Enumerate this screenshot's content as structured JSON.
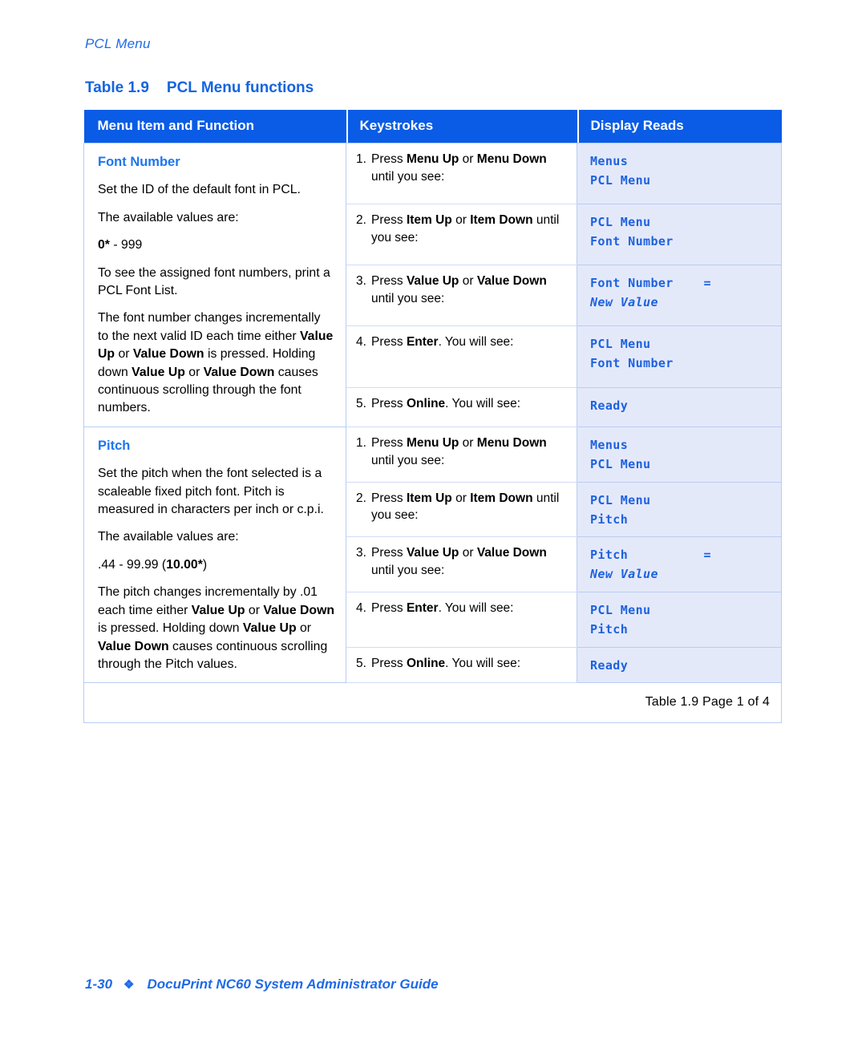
{
  "running_head": "PCL Menu",
  "table_caption": {
    "number": "Table 1.9",
    "title": "PCL Menu functions"
  },
  "colors": {
    "header_blue": "#0A5CE6",
    "accent_blue": "#1D75F0",
    "display_bg": "#E4E9FA",
    "display_text": "#1D62DE",
    "border_blue": "#B9CDF2"
  },
  "columns": [
    {
      "label": "Menu Item and Function"
    },
    {
      "label": "Keystrokes"
    },
    {
      "label": "Display Reads"
    }
  ],
  "sections": [
    {
      "function": {
        "title": "Font Number",
        "paragraphs": [
          [
            {
              "t": "Set the ID of the default font in PCL.",
              "b": false
            }
          ],
          [
            {
              "t": "The available values are:",
              "b": false
            }
          ],
          [
            {
              "t": "0*",
              "b": true
            },
            {
              "t": " - 999",
              "b": false
            }
          ],
          [
            {
              "t": "To see the assigned font numbers, print a PCL Font List.",
              "b": false
            }
          ],
          [
            {
              "t": "The font number changes incrementally to the next valid ID each time either ",
              "b": false
            },
            {
              "t": "Value Up",
              "b": true
            },
            {
              "t": " or ",
              "b": false
            },
            {
              "t": "Value Down",
              "b": true
            },
            {
              "t": " is pressed. Holding down ",
              "b": false
            },
            {
              "t": "Value Up",
              "b": true
            },
            {
              "t": " or ",
              "b": false
            },
            {
              "t": "Value Down",
              "b": true
            },
            {
              "t": " causes continuous scrolling through the font numbers.",
              "b": false
            }
          ]
        ]
      },
      "steps": [
        {
          "num": "1.",
          "keystroke": [
            {
              "t": "Press ",
              "b": false
            },
            {
              "t": "Menu Up",
              "b": true
            },
            {
              "t": " or ",
              "b": false
            },
            {
              "t": "Menu Down",
              "b": true
            },
            {
              "t": " until you see:",
              "b": false
            }
          ],
          "display": [
            {
              "text": "Menus",
              "italic": false
            },
            {
              "text": "PCL Menu",
              "italic": false
            }
          ]
        },
        {
          "num": "2.",
          "keystroke": [
            {
              "t": "Press ",
              "b": false
            },
            {
              "t": "Item Up",
              "b": true
            },
            {
              "t": " or ",
              "b": false
            },
            {
              "t": "Item Down",
              "b": true
            },
            {
              "t": " until you see:",
              "b": false
            }
          ],
          "display": [
            {
              "text": "PCL Menu",
              "italic": false
            },
            {
              "text": "Font Number",
              "italic": false
            }
          ]
        },
        {
          "num": "3.",
          "keystroke": [
            {
              "t": "Press ",
              "b": false
            },
            {
              "t": "Value Up",
              "b": true
            },
            {
              "t": " or ",
              "b": false
            },
            {
              "t": "Value Down",
              "b": true
            },
            {
              "t": " until you see:",
              "b": false
            }
          ],
          "display": [
            {
              "text": "Font Number    =",
              "italic": false
            },
            {
              "text": "New Value",
              "italic": true
            }
          ]
        },
        {
          "num": "4.",
          "keystroke": [
            {
              "t": "Press ",
              "b": false
            },
            {
              "t": "Enter",
              "b": true
            },
            {
              "t": ". You will see:",
              "b": false
            }
          ],
          "display": [
            {
              "text": "PCL Menu",
              "italic": false
            },
            {
              "text": "Font Number",
              "italic": false
            }
          ]
        },
        {
          "num": "5.",
          "keystroke": [
            {
              "t": "Press ",
              "b": false
            },
            {
              "t": "Online",
              "b": true
            },
            {
              "t": ". You will see:",
              "b": false
            }
          ],
          "display": [
            {
              "text": "Ready",
              "italic": false
            }
          ]
        }
      ]
    },
    {
      "function": {
        "title": "Pitch",
        "paragraphs": [
          [
            {
              "t": "Set the pitch when the font selected is a scaleable fixed pitch font. Pitch is measured in characters per inch or c.p.i.",
              "b": false
            }
          ],
          [
            {
              "t": "The available values are:",
              "b": false
            }
          ],
          [
            {
              "t": ".44 - 99.99 (",
              "b": false
            },
            {
              "t": "10.00*",
              "b": true
            },
            {
              "t": ")",
              "b": false
            }
          ],
          [
            {
              "t": "The pitch changes incrementally by .01 each time either ",
              "b": false
            },
            {
              "t": "Value Up",
              "b": true
            },
            {
              "t": " or ",
              "b": false
            },
            {
              "t": "Value Down",
              "b": true
            },
            {
              "t": " is pressed. Holding down ",
              "b": false
            },
            {
              "t": "Value Up",
              "b": true
            },
            {
              "t": " or ",
              "b": false
            },
            {
              "t": "Value Down",
              "b": true
            },
            {
              "t": " causes continuous scrolling through the Pitch values.",
              "b": false
            }
          ]
        ]
      },
      "steps": [
        {
          "num": "1.",
          "keystroke": [
            {
              "t": "Press ",
              "b": false
            },
            {
              "t": "Menu Up",
              "b": true
            },
            {
              "t": " or ",
              "b": false
            },
            {
              "t": "Menu Down",
              "b": true
            },
            {
              "t": " until you see:",
              "b": false
            }
          ],
          "display": [
            {
              "text": "Menus",
              "italic": false
            },
            {
              "text": "PCL Menu",
              "italic": false
            }
          ]
        },
        {
          "num": "2.",
          "keystroke": [
            {
              "t": "Press ",
              "b": false
            },
            {
              "t": "Item Up",
              "b": true
            },
            {
              "t": " or ",
              "b": false
            },
            {
              "t": "Item Down",
              "b": true
            },
            {
              "t": " until you see:",
              "b": false
            }
          ],
          "display": [
            {
              "text": "PCL Menu",
              "italic": false
            },
            {
              "text": "Pitch",
              "italic": false
            }
          ]
        },
        {
          "num": "3.",
          "keystroke": [
            {
              "t": "Press ",
              "b": false
            },
            {
              "t": "Value Up",
              "b": true
            },
            {
              "t": " or ",
              "b": false
            },
            {
              "t": "Value Down",
              "b": true
            },
            {
              "t": " until you see:",
              "b": false
            }
          ],
          "display": [
            {
              "text": "Pitch          =",
              "italic": false
            },
            {
              "text": "New Value",
              "italic": true
            }
          ]
        },
        {
          "num": "4.",
          "keystroke": [
            {
              "t": "Press ",
              "b": false
            },
            {
              "t": "Enter",
              "b": true
            },
            {
              "t": ". You will see:",
              "b": false
            }
          ],
          "display": [
            {
              "text": "PCL Menu",
              "italic": false
            },
            {
              "text": "Pitch",
              "italic": false
            }
          ]
        },
        {
          "num": "5.",
          "keystroke": [
            {
              "t": "Press ",
              "b": false
            },
            {
              "t": "Online",
              "b": true
            },
            {
              "t": ". You will see:",
              "b": false
            }
          ],
          "display": [
            {
              "text": "Ready",
              "italic": false
            }
          ]
        }
      ]
    }
  ],
  "table_footer": "Table 1.9  Page 1 of 4",
  "page_footer": {
    "page_number": "1-30",
    "separator_icon": "diamond-bullet",
    "separator_glyph": "❖",
    "title": "DocuPrint NC60 System Administrator Guide"
  }
}
